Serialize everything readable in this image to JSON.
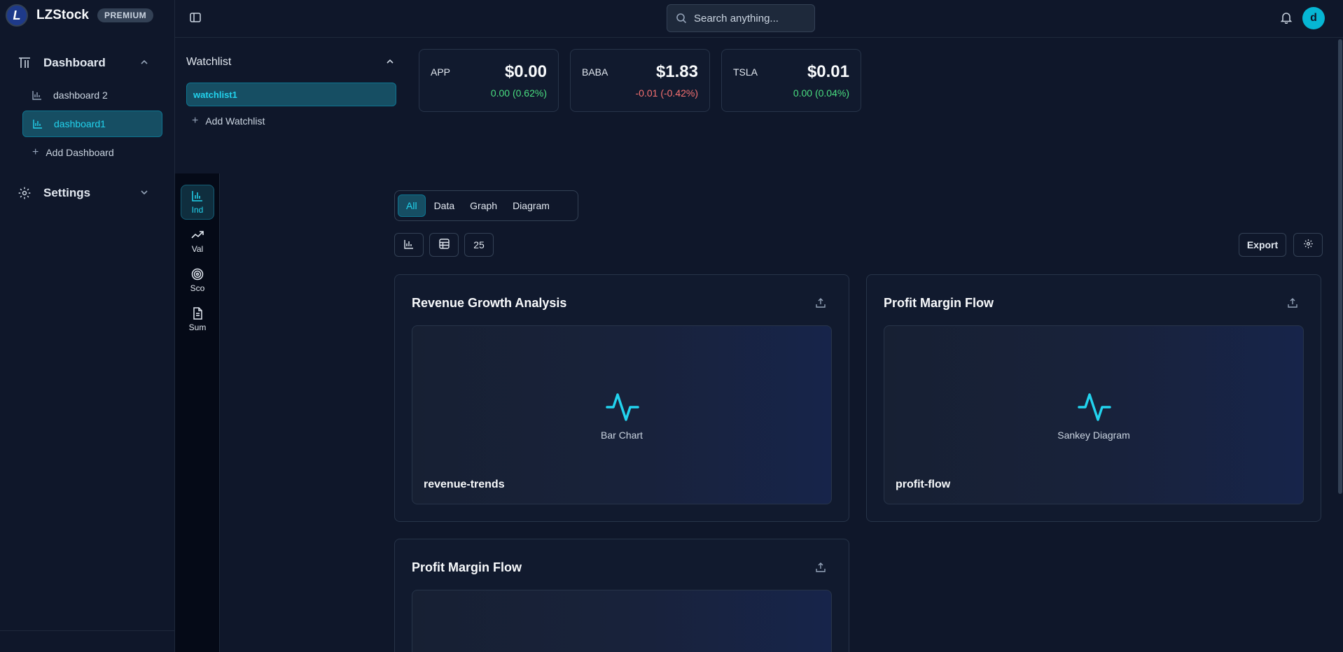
{
  "brand": {
    "logo_letter": "L",
    "name": "LZStock",
    "badge": "PREMIUM"
  },
  "sidebar": {
    "dashboard_label": "Dashboard",
    "dashboards": [
      {
        "label": "dashboard 2",
        "active": false
      },
      {
        "label": "dashboard1",
        "active": true
      }
    ],
    "add_dashboard": "Add Dashboard",
    "settings_label": "Settings"
  },
  "topbar": {
    "search_placeholder": "Search anything...",
    "avatar_letter": "d"
  },
  "watchlist": {
    "title": "Watchlist",
    "items": [
      "watchlist1"
    ],
    "add_label": "Add Watchlist"
  },
  "tickers": [
    {
      "symbol": "APP",
      "price": "$0.00",
      "change": "0.00 (0.62%)",
      "direction": "up"
    },
    {
      "symbol": "BABA",
      "price": "$1.83",
      "change": "-0.01 (-0.42%)",
      "direction": "down"
    },
    {
      "symbol": "TSLA",
      "price": "$0.01",
      "change": "0.00 (0.04%)",
      "direction": "up"
    }
  ],
  "rail": [
    {
      "label": "Ind",
      "icon": "bar-chart-icon",
      "active": true
    },
    {
      "label": "Val",
      "icon": "trending-up-icon",
      "active": false
    },
    {
      "label": "Sco",
      "icon": "target-icon",
      "active": false
    },
    {
      "label": "Sum",
      "icon": "document-icon",
      "active": false
    }
  ],
  "filters": {
    "tabs": [
      "All",
      "Data",
      "Graph",
      "Diagram"
    ],
    "active": "All",
    "page_size": "25",
    "export_label": "Export"
  },
  "cards": [
    {
      "title": "Revenue Growth Analysis",
      "type": "Bar Chart",
      "name": "revenue-trends"
    },
    {
      "title": "Profit Margin Flow",
      "type": "Sankey Diagram",
      "name": "profit-flow"
    },
    {
      "title": "Profit Margin Flow",
      "type": "",
      "name": ""
    }
  ],
  "colors": {
    "background": "#0f172a",
    "accent": "#22d3ee",
    "positive": "#4ade80",
    "negative": "#f87171"
  }
}
